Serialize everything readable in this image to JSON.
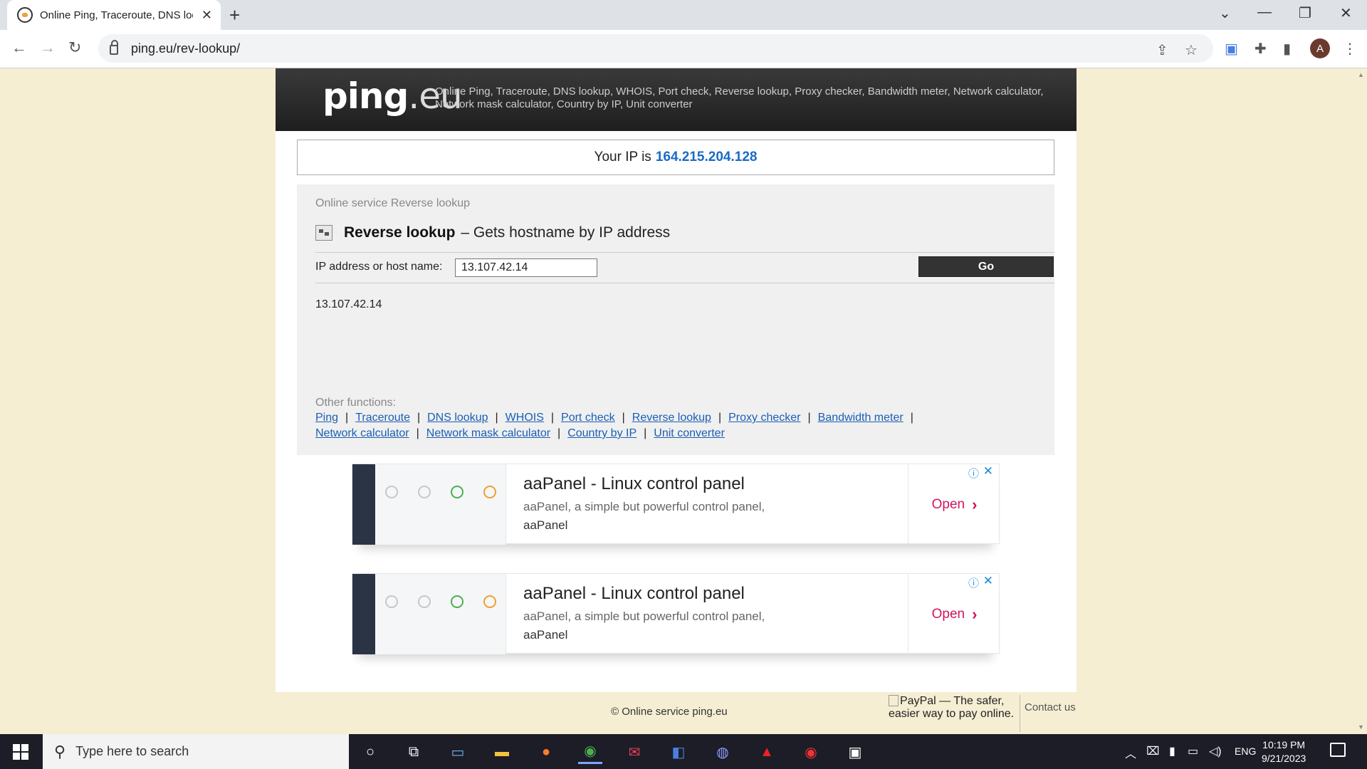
{
  "browser": {
    "tab_title": "Online Ping, Traceroute, DNS loo",
    "new_tab": "+",
    "close_tab": "✕",
    "url": "ping.eu/rev-lookup/",
    "profile_initial": "A",
    "window_controls": {
      "dropdown": "⌄",
      "minimize": "—",
      "restore": "❐",
      "close": "✕"
    }
  },
  "header": {
    "logo_ping": "ping",
    "logo_eu": ".eu",
    "description": "Online Ping, Traceroute, DNS lookup, WHOIS, Port check, Reverse lookup, Proxy checker, Bandwidth meter, Network calculator, Network mask calculator, Country by IP, Unit converter"
  },
  "ipbox": {
    "label": "Your IP is",
    "ip": "164.215.204.128"
  },
  "service": {
    "breadcrumb": "Online service Reverse lookup",
    "title": "Reverse lookup",
    "subtitle": "– Gets hostname by IP address",
    "form_label": "IP address or host name:",
    "input_value": "13.107.42.14",
    "go_label": "Go",
    "result": "13.107.42.14",
    "other_label": "Other functions:",
    "links": [
      "Ping",
      "Traceroute",
      "DNS lookup",
      "WHOIS",
      "Port check",
      "Reverse lookup",
      "Proxy checker",
      "Bandwidth meter",
      "Network calculator",
      "Network mask calculator",
      "Country by IP",
      "Unit converter"
    ]
  },
  "ads": [
    {
      "title": "aaPanel - Linux control panel",
      "desc": "aaPanel, a simple but powerful control panel,",
      "brand": "aaPanel",
      "cta": "Open",
      "info": "ⓘ",
      "close": "✕"
    },
    {
      "title": "aaPanel - Linux control panel",
      "desc": "aaPanel, a simple but powerful control panel,",
      "brand": "aaPanel",
      "cta": "Open",
      "info": "ⓘ",
      "close": "✕"
    }
  ],
  "footer": {
    "copyright": "© Online service ping.eu",
    "paypal_alt": "PayPal — The safer, easier way to pay online.",
    "contact": "Contact us"
  },
  "taskbar": {
    "search_placeholder": "Type here to search",
    "language": "ENG",
    "time": "10:19 PM",
    "date": "9/21/2023"
  },
  "colors": {
    "accent_link": "#1a5fb4",
    "ip_blue": "#1a6bc4",
    "ad_cta": "#d0155f",
    "page_bg": "#f5eed3"
  }
}
